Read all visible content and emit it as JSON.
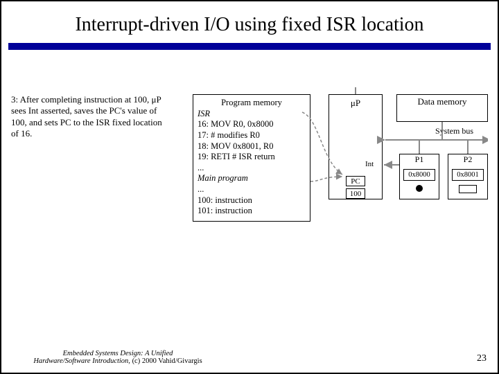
{
  "title": "Interrupt-driven I/O using fixed ISR location",
  "step_text": "3: After completing instruction at 100, μP sees Int asserted, saves the PC's value of 100, and sets PC to the ISR fixed location of 16.",
  "program_memory": {
    "header": "Program memory",
    "section1": "ISR",
    "lines": [
      "16:  MOV R0, 0x8000",
      "17:  # modifies R0",
      "18:  MOV 0x8001, R0",
      "19:  RETI  # ISR return",
      "..."
    ],
    "section2": "Main program",
    "lines2": [
      "...",
      "100: instruction",
      "101: instruction"
    ]
  },
  "up": {
    "label": "μP",
    "int_label": "Int",
    "pc_label": "PC",
    "pc_value": "100"
  },
  "data_memory_label": "Data memory",
  "system_bus_label": "System bus",
  "p1": {
    "label": "P1",
    "addr": "0x8000"
  },
  "p2": {
    "label": "P2",
    "addr": "0x8001"
  },
  "footer": {
    "line1": "Embedded Systems Design: A Unified",
    "line2a": "Hardware/Software Introduction,",
    "line2b": " (c) 2000 Vahid/Givargis"
  },
  "page_number": "23"
}
